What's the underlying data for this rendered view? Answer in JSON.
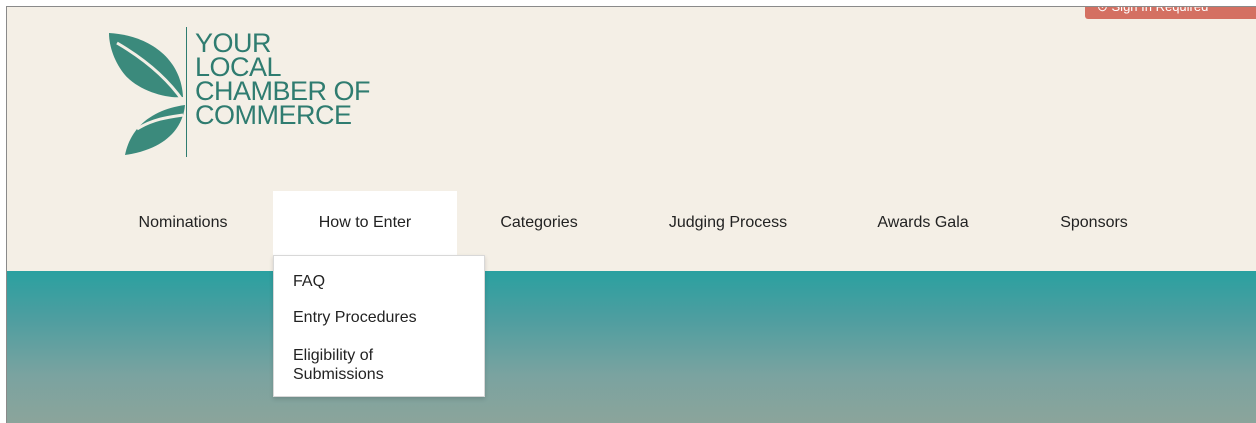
{
  "top_tab": {
    "label": "⊙ Sign In Required"
  },
  "logo": {
    "lines": [
      "YOUR",
      "LOCAL",
      "CHAMBER OF",
      "COMMERCE"
    ],
    "color": "#2f7c70",
    "icon": "leaf-butterfly-icon"
  },
  "nav": {
    "items": [
      {
        "label": "Nominations"
      },
      {
        "label": "How to Enter",
        "active": true
      },
      {
        "label": "Categories"
      },
      {
        "label": "Judging Process"
      },
      {
        "label": "Awards Gala"
      },
      {
        "label": "Sponsors"
      }
    ]
  },
  "dropdown": {
    "items": [
      {
        "label": "FAQ"
      },
      {
        "label": "Entry Procedures"
      },
      {
        "label": "Eligibility of Submissions"
      }
    ]
  },
  "colors": {
    "background": "#f4efe6",
    "accent": "#2f7c70",
    "hero_top": "#2aa0a0",
    "hero_bottom": "#8ea49a",
    "top_tab": "#d47062"
  }
}
